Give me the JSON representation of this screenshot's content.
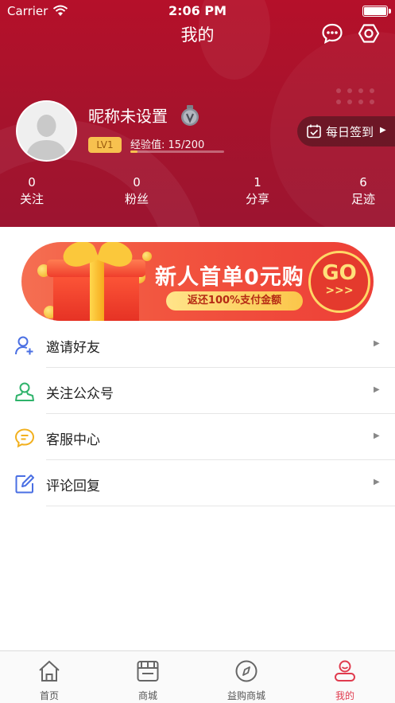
{
  "status_bar": {
    "carrier": "Carrier",
    "time": "2:06 PM"
  },
  "header": {
    "title": "我的"
  },
  "profile": {
    "nickname": "昵称未设置",
    "level": "LV1",
    "exp_label": "经验值:",
    "exp_value": "15/200",
    "exp_progress": 0.075,
    "checkin_label": "每日签到"
  },
  "stats": [
    {
      "value": "0",
      "label": "关注"
    },
    {
      "value": "0",
      "label": "粉丝"
    },
    {
      "value": "1",
      "label": "分享"
    },
    {
      "value": "6",
      "label": "足迹"
    }
  ],
  "banner": {
    "headline": "新人首单0元购",
    "subline": "返还100%支付金额",
    "go_label": "GO",
    "go_sub": ">>>"
  },
  "menu": [
    {
      "label": "邀请好友",
      "icon": "invite-user-icon"
    },
    {
      "label": "关注公众号",
      "icon": "user-follow-icon"
    },
    {
      "label": "客服中心",
      "icon": "chat-bubble-icon"
    },
    {
      "label": "评论回复",
      "icon": "edit-icon"
    }
  ],
  "tabbar": [
    {
      "label": "首页",
      "icon": "home-icon"
    },
    {
      "label": "商城",
      "icon": "store-icon"
    },
    {
      "label": "益购商城",
      "icon": "compass-icon"
    },
    {
      "label": "我的",
      "icon": "profile-icon",
      "active": true
    }
  ],
  "colors": {
    "header": "#a8132c",
    "accent": "#e03b4e",
    "level_badge": "#f7c14f"
  }
}
